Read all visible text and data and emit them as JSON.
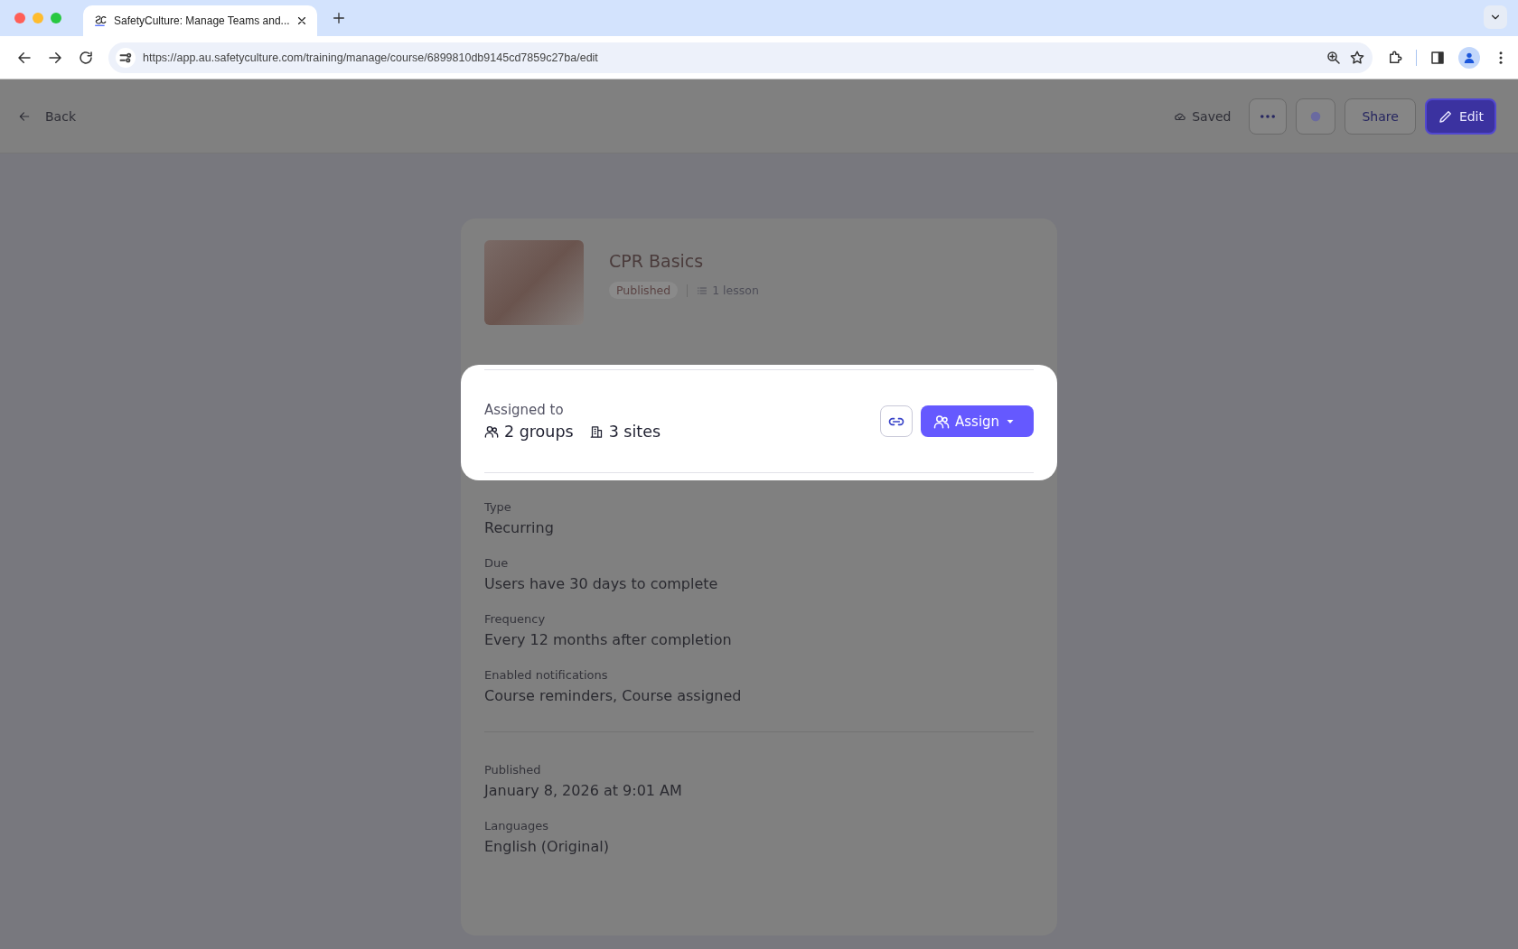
{
  "browser": {
    "tab_title": "SafetyCulture: Manage Teams and...",
    "url": "https://app.au.safetyculture.com/training/manage/course/6899810db9145cd7859c27ba/edit"
  },
  "header": {
    "back": "Back",
    "saved": "Saved",
    "share": "Share",
    "edit": "Edit"
  },
  "course": {
    "title": "CPR Basics",
    "status": "Published",
    "lessons": "1 lesson"
  },
  "assignment": {
    "label": "Assigned to",
    "groups": "2 groups",
    "sites": "3 sites",
    "assign_button": "Assign"
  },
  "details": [
    {
      "label": "Type",
      "value": "Recurring"
    },
    {
      "label": "Due",
      "value": "Users have 30 days to complete"
    },
    {
      "label": "Frequency",
      "value": "Every 12 months after completion"
    },
    {
      "label": "Enabled notifications",
      "value": "Course reminders, Course assigned"
    }
  ],
  "publishing": [
    {
      "label": "Published",
      "value": "January 8, 2026 at 9:01 AM"
    },
    {
      "label": "Languages",
      "value": "English (Original)"
    }
  ]
}
